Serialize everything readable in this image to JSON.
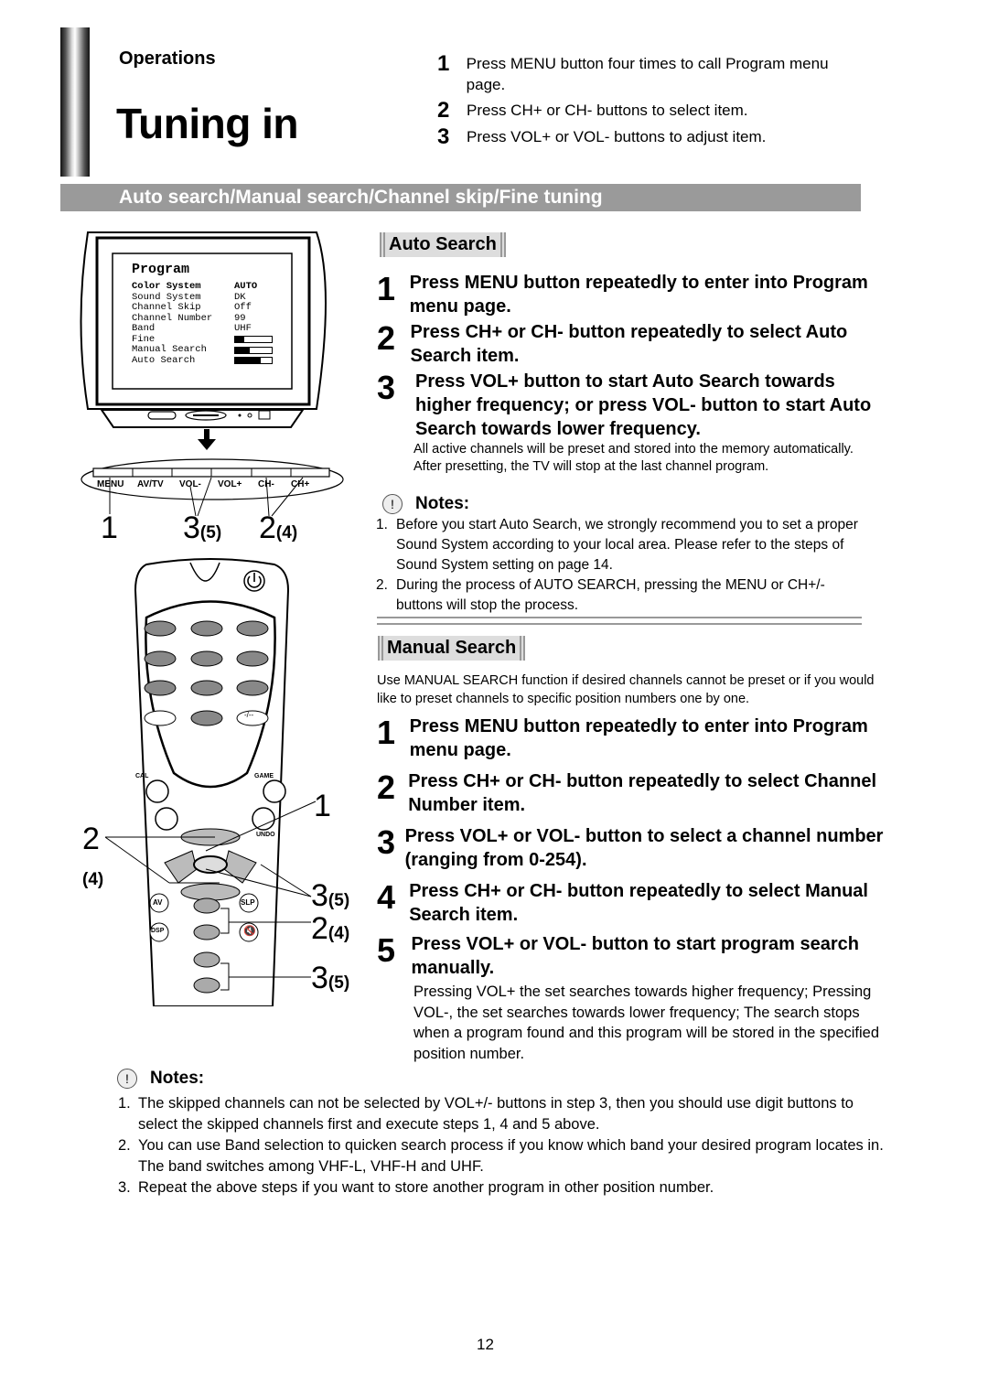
{
  "header": {
    "section": "Operations",
    "title": "Tuning in",
    "steps": [
      {
        "num": "1",
        "text": "Press MENU button four times to call Program menu page."
      },
      {
        "num": "2",
        "text": "Press CH+ or CH- buttons to select item."
      },
      {
        "num": "3",
        "text": "Press VOL+ or VOL- buttons to adjust item."
      }
    ]
  },
  "band_title": "Auto search/Manual search/Channel skip/Fine tuning",
  "tv_menu": {
    "title": "Program",
    "items": [
      {
        "label": "Color System",
        "value": "AUTO"
      },
      {
        "label": "Sound System",
        "value": "DK"
      },
      {
        "label": "Channel Skip",
        "value": "Off"
      },
      {
        "label": "Channel Number",
        "value": "99"
      },
      {
        "label": "Band",
        "value": "UHF"
      },
      {
        "label": "Fine",
        "level": 0.25
      },
      {
        "label": "Manual Search",
        "level": 0.4
      },
      {
        "label": "Auto Search",
        "level": 0.7
      }
    ]
  },
  "panel_buttons": [
    "MENU",
    "AV/TV",
    "VOL-",
    "VOL+",
    "CH-",
    "CH+"
  ],
  "panel_callouts": [
    {
      "num": "1",
      "sub": ""
    },
    {
      "num": "3",
      "sub": "(5)"
    },
    {
      "num": "2",
      "sub": "(4)"
    }
  ],
  "remote": {
    "labels": {
      "cal": "CAL",
      "game": "GAME",
      "undo": "UNDO",
      "av": "AV",
      "slp": "SLP",
      "dsp": "DSP",
      "dash": "-/--"
    },
    "callouts": [
      {
        "num": "1",
        "sub": ""
      },
      {
        "num": "2",
        "sub": "(4)"
      },
      {
        "num": "3",
        "sub": "(5)"
      },
      {
        "num": "2",
        "sub": "(4)"
      },
      {
        "num": "3",
        "sub": "(5)"
      }
    ]
  },
  "auto_search": {
    "heading": "Auto Search",
    "steps": [
      {
        "num": "1",
        "text": "Press MENU button repeatedly to enter into Program menu page."
      },
      {
        "num": "2",
        "text": "Press CH+ or CH- button repeatedly to select Auto Search item."
      },
      {
        "num": "3",
        "text": "Press VOL+ button to start Auto Search towards higher frequency; or press VOL- button to start Auto Search towards lower frequency."
      }
    ],
    "detail": "All active channels will be preset and stored into the memory automatically. After presetting, the TV will stop at the last channel program.",
    "notes_heading": "Notes:",
    "notes": [
      {
        "num": "1.",
        "text": "Before you start Auto Search, we strongly recommend you to set a proper Sound System according to your local area. Please refer to the steps of Sound System setting on page 14."
      },
      {
        "num": "2.",
        "text": "During the process of AUTO SEARCH, pressing the MENU or CH+/- buttons will stop the process."
      }
    ]
  },
  "manual_search": {
    "heading": "Manual Search",
    "intro": "Use MANUAL SEARCH function if desired channels cannot be preset or if you would like to preset channels to specific position numbers one by one.",
    "steps": [
      {
        "num": "1",
        "text": "Press MENU button repeatedly to enter into Program menu page."
      },
      {
        "num": "2",
        "text": "Press CH+ or CH- button repeatedly to select Channel Number item."
      },
      {
        "num": "3",
        "text": "Press VOL+ or VOL- button to select a channel number (ranging from 0-254)."
      },
      {
        "num": "4",
        "text": "Press CH+ or CH- button repeatedly to select Manual Search item."
      },
      {
        "num": "5",
        "text": "Press VOL+ or VOL- button to start program search manually."
      }
    ],
    "detail": "Pressing VOL+ the set searches towards higher frequency; Pressing VOL-, the set searches towards lower frequency; The search stops when a program found and this program will be stored in the specified position number."
  },
  "bottom_notes": {
    "heading": "Notes:",
    "items": [
      {
        "num": "1.",
        "text": "The skipped channels can not be selected by VOL+/- buttons in step 3, then you should use digit buttons to select the skipped channels first and execute steps 1, 4 and 5 above."
      },
      {
        "num": "2.",
        "text": "You can use Band selection to quicken search process if you know which band your desired program locates in. The band switches among VHF-L, VHF-H and UHF."
      },
      {
        "num": "3.",
        "text": "Repeat the above steps if you want to store another program in other position number."
      }
    ]
  },
  "page_number": "12"
}
